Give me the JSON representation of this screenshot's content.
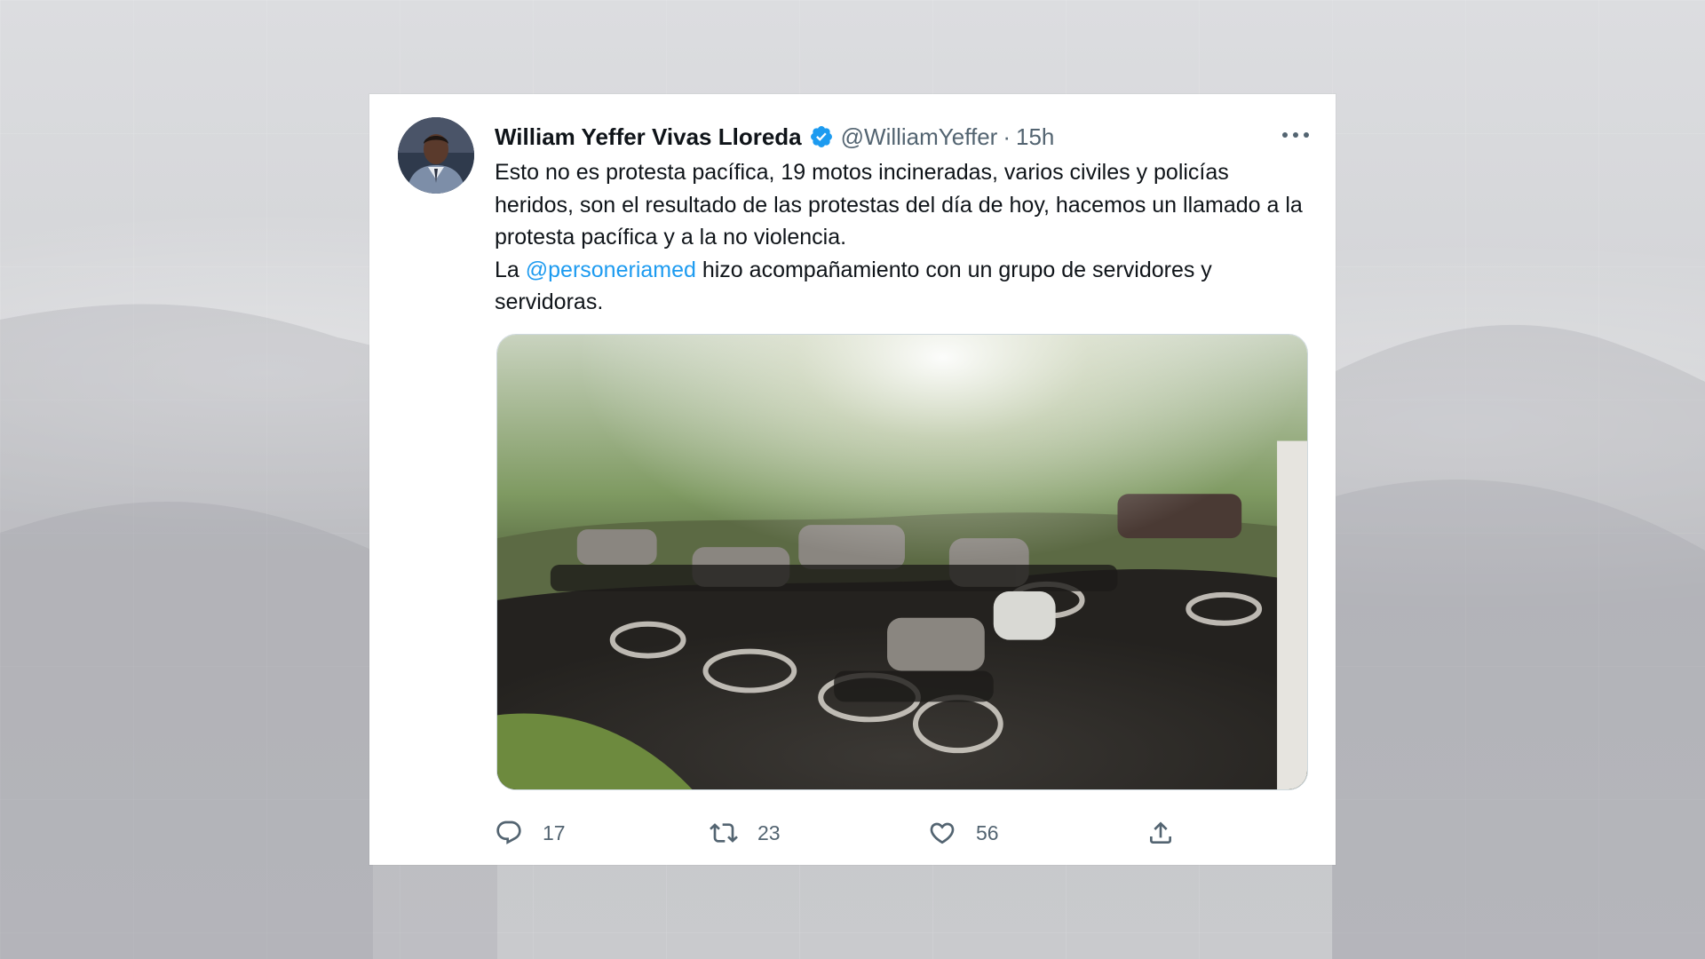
{
  "tweet": {
    "display_name": "William Yeffer Vivas Lloreda",
    "handle": "@WilliamYeffer",
    "separator": "·",
    "time": "15h",
    "text_line1": "Esto no es protesta pacífica, 19 motos incineradas, varios civiles y policías heridos, son el resultado de las protestas del día de hoy, hacemos un llamado a la protesta pacífica y a la no violencia.",
    "text_line2_prefix": "La ",
    "mention": "@personeriamed",
    "text_line2_suffix": " hizo acompañamiento con un grupo de servidores y servidoras.",
    "media_alt": "",
    "icons": {
      "verified": "verified-badge-icon",
      "more": "more-options-icon",
      "reply": "reply-icon",
      "retweet": "retweet-icon",
      "like": "heart-icon",
      "share": "share-icon"
    },
    "actions": {
      "replies": "17",
      "retweets": "23",
      "likes": "56"
    }
  },
  "colors": {
    "verified": "#1d9bf0",
    "mention": "#1d9bf0",
    "text": "#0f1419",
    "secondary": "#536471"
  }
}
